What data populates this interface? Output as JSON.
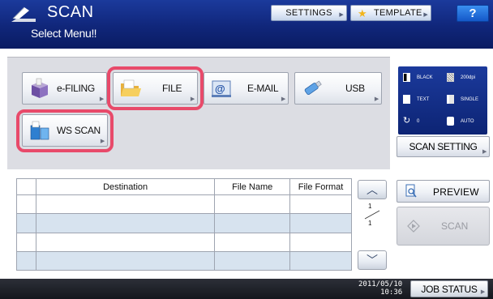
{
  "header": {
    "title": "SCAN",
    "subtitle": "Select Menu‼",
    "settings_label": "SETTINGS",
    "template_label": "TEMPLATE",
    "help_label": "?"
  },
  "functions": [
    {
      "label": "e-FILING",
      "icon": "box-icon"
    },
    {
      "label": "FILE",
      "icon": "folder-icon"
    },
    {
      "label": "E-MAIL",
      "icon": "email-icon"
    },
    {
      "label": "USB",
      "icon": "usb-icon"
    },
    {
      "label": "WS SCAN",
      "icon": "ws-scan-icon"
    }
  ],
  "scan_settings": {
    "color_mode": "BLACK",
    "resolution": "200dpi",
    "original_mode": "TEXT",
    "duplex": "SINGLE",
    "rotation": "0",
    "original_size": "AUTO",
    "button_label": "SCAN SETTING"
  },
  "destination_table": {
    "headers": [
      "Destination",
      "File Name",
      "File Format"
    ],
    "page_current": "1",
    "page_total": "1"
  },
  "actions": {
    "preview_label": "PREVIEW",
    "scan_label": "SCAN"
  },
  "footer": {
    "date": "2011/05/10",
    "time": "10:36",
    "job_status_label": "JOB STATUS"
  },
  "colors": {
    "header_blue": "#10267a",
    "highlight": "#e84a6a",
    "row_alt": "#d7e3ef",
    "panel_gray": "#dcdde3"
  }
}
